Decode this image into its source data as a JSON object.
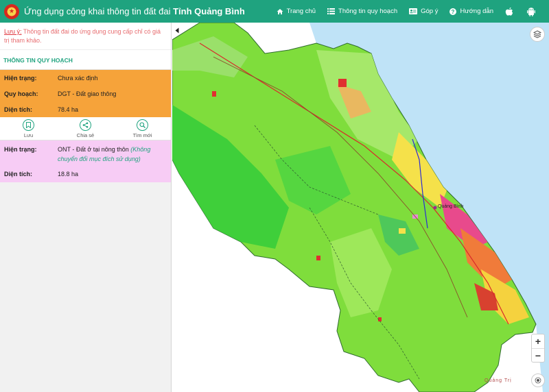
{
  "header": {
    "title_main": "Ứng dụng công khai thông tin đất đai ",
    "title_bold": "Tỉnh Quảng Bình",
    "nav": [
      {
        "label": "Trang chủ",
        "icon": "home-icon"
      },
      {
        "label": "Thông tin quy hoạch",
        "icon": "list-icon"
      },
      {
        "label": "Góp ý",
        "icon": "id-card-icon"
      },
      {
        "label": "Hướng dẫn",
        "icon": "question-icon"
      }
    ],
    "platform_icons": [
      "apple-icon",
      "android-icon"
    ]
  },
  "sidebar": {
    "note_label": "Lưu ý:",
    "note_text": " Thông tin đất đai do ứng dụng cung cấp chỉ có giá trị tham khảo.",
    "section_title": "THÔNG TIN QUY HOẠCH",
    "block1": {
      "hien_trang_label": "Hiện trạng:",
      "hien_trang_value": "Chưa xác định",
      "quy_hoach_label": "Quy hoạch:",
      "quy_hoach_value": "DGT - Đất giao thông",
      "dien_tich_label": "Diện tích:",
      "dien_tich_value": "78.4 ha"
    },
    "actions": [
      {
        "label": "Lưu",
        "icon": "bookmark-icon"
      },
      {
        "label": "Chia sẻ",
        "icon": "share-icon"
      },
      {
        "label": "Tìm mới",
        "icon": "search-icon"
      }
    ],
    "block2": {
      "hien_trang_label": "Hiện trạng:",
      "hien_trang_value": "ONT - Đất ở tại nông thôn ",
      "hien_trang_note": "(Không chuyển đổi mục đích sử dụng)",
      "dien_tich_label": "Diện tích:",
      "dien_tich_value": "18.8 ha"
    }
  },
  "map": {
    "place_labels": [
      "Quảng Bình",
      "Quảng Trị"
    ],
    "zoom_in": "+",
    "zoom_out": "−"
  },
  "colors": {
    "header": "#1fa37f",
    "orange_block": "#f6a33a",
    "pink_block": "#f7ccf5",
    "sea": "#bfe3f7",
    "land_green": "#7fdd3c"
  }
}
